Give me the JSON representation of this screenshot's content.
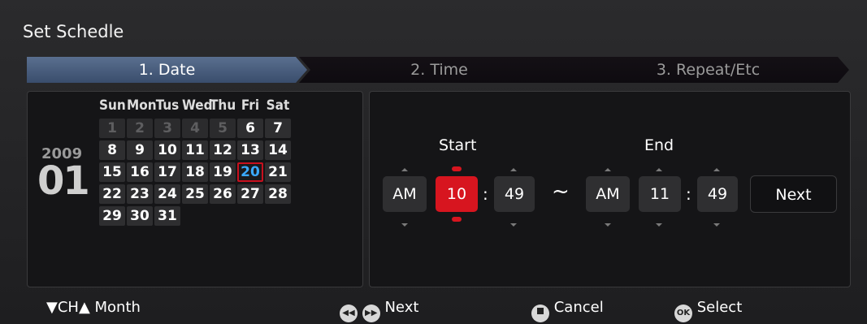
{
  "dialog": {
    "title": "Set Schedle"
  },
  "steps": [
    {
      "label": "1. Date",
      "active": true
    },
    {
      "label": "2. Time",
      "active": false
    },
    {
      "label": "3. Repeat/Etc",
      "active": false
    }
  ],
  "calendar": {
    "year": "2009",
    "month": "01",
    "weekdays": [
      "Sun",
      "Mon",
      "Tus",
      "Wed",
      "Thu",
      "Fri",
      "Sat"
    ],
    "weeks": [
      [
        {
          "d": "1",
          "prev": true
        },
        {
          "d": "2",
          "prev": true
        },
        {
          "d": "3",
          "prev": true
        },
        {
          "d": "4",
          "prev": true
        },
        {
          "d": "5",
          "prev": true
        },
        {
          "d": "6"
        },
        {
          "d": "7"
        }
      ],
      [
        {
          "d": "8"
        },
        {
          "d": "9"
        },
        {
          "d": "10"
        },
        {
          "d": "11"
        },
        {
          "d": "12"
        },
        {
          "d": "13"
        },
        {
          "d": "14"
        }
      ],
      [
        {
          "d": "15"
        },
        {
          "d": "16"
        },
        {
          "d": "17"
        },
        {
          "d": "18"
        },
        {
          "d": "19"
        },
        {
          "d": "20",
          "today": true
        },
        {
          "d": "21"
        }
      ],
      [
        {
          "d": "22"
        },
        {
          "d": "23"
        },
        {
          "d": "24"
        },
        {
          "d": "25"
        },
        {
          "d": "26"
        },
        {
          "d": "27"
        },
        {
          "d": "28"
        }
      ],
      [
        {
          "d": "29"
        },
        {
          "d": "30"
        },
        {
          "d": "31"
        }
      ]
    ]
  },
  "time": {
    "start_label": "Start",
    "end_label": "End",
    "start": {
      "ampm": "AM",
      "hour": "10",
      "minute": "49"
    },
    "end": {
      "ampm": "AM",
      "hour": "11",
      "minute": "49"
    },
    "separator": ":",
    "range_symbol": "~",
    "next_label": "Next"
  },
  "footer": {
    "month_hint": "▼CH▲ Month",
    "next_hint": "Next",
    "cancel_hint": "Cancel",
    "select_hint": "Select",
    "ok_icon_text": "OK"
  }
}
